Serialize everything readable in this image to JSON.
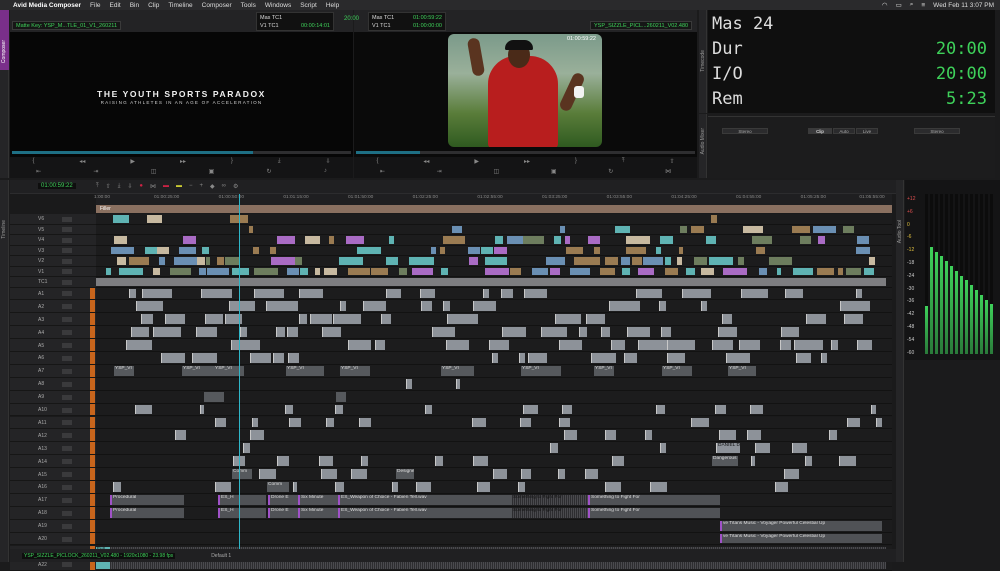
{
  "menubar": {
    "app": "Avid Media Composer",
    "items": [
      "File",
      "Edit",
      "Bin",
      "Clip",
      "Timeline",
      "Composer",
      "Tools",
      "Windows",
      "Script",
      "Help"
    ],
    "clock": "Wed Feb 11  3:07 PM"
  },
  "side_tabs": {
    "composer": "Composer",
    "timeline": "Timeline",
    "audio_tool": "Audio Tool",
    "timecode": "Timecode",
    "audio_mixer": "Audio Mixer"
  },
  "source_monitor": {
    "clip_name": "Matte Key: YSP_M...TLE_01_V1_260211",
    "tc_box": {
      "row1_label": "Mas TC1",
      "row2_label": "V1  TC1",
      "row2_value": "00:00:14:01"
    },
    "title_text": "THE YOUTH SPORTS PARADOX",
    "subtitle_text": "RAISING ATHLETES IN AN AGE OF ACCELERATION"
  },
  "center_tc": "20:00",
  "record_monitor": {
    "clip_name": "YSP_SIZZLE_PICL...260211_V02.480",
    "tc_box": {
      "row1_label": "Mas TC1",
      "row1_value": "01:00:59:22",
      "row2_label": "V1  TC1",
      "row2_value": "01:00:00:00"
    },
    "frame_tc": "01:00:59:22"
  },
  "timecode_window": {
    "rows": [
      {
        "label": "Mas 24",
        "value": ""
      },
      {
        "label": "Dur",
        "value": "20:00"
      },
      {
        "label": "I/O",
        "value": "20:00"
      },
      {
        "label": "Rem",
        "value": "5:23"
      }
    ]
  },
  "audio_mixer": {
    "buttons": [
      "Stereo",
      "Clip",
      "Auto",
      "Live",
      "Stereo"
    ]
  },
  "timeline": {
    "position_tc": "01:00:59:22",
    "filler_label": "Filler",
    "ruler": [
      "1:00:00",
      "01:00:25:00",
      "01:00:50:00",
      "01:01:15:00",
      "01:01:50:00",
      "01:02:25:00",
      "01:02:55:00",
      "01:03:25:00",
      "01:03:55:00",
      "01:04:25:00",
      "01:04:55:00",
      "01:05:25:00",
      "01:05:55:00"
    ],
    "tracks": [
      "V6",
      "V5",
      "V4",
      "V3",
      "V2",
      "V1",
      "TC1",
      "A1",
      "A2",
      "A3",
      "A4",
      "A5",
      "A6",
      "A7",
      "A8",
      "A9",
      "A10",
      "A11",
      "A12",
      "A13",
      "A14",
      "A15",
      "A16",
      "A17",
      "A18",
      "A19",
      "A20",
      "A21",
      "A22"
    ],
    "clips": {
      "procedural": "Procedural",
      "es_h": "ES_H",
      "drone": "Drone E",
      "six_minute": "Six Minute",
      "weapon": "ES_Weapon of Choice - Fabien Tell.wav",
      "something": "Something to Fight For",
      "titans": "ve Titans Music - Voyager   Powerful Celestial Up",
      "dangerous": "Dangerous",
      "comm": "Comm",
      "designed": "Designed",
      "drone_s": "Drone",
      "full": "Full",
      "ysp_vi": "YSP_VI",
      "daniel": "DANIEL D"
    },
    "status": {
      "sequence": "YSP_SIZZLE_PICLOCK_260211_V02.480 - 1920x1080 - 23.98 fps",
      "setting": "Default 1"
    }
  },
  "meters": {
    "scale": [
      "+12",
      "+6",
      "0",
      "-6",
      "-12",
      "-18",
      "-24",
      "-30",
      "-36",
      "-42",
      "-48",
      "-54",
      "-60"
    ]
  },
  "colors": {
    "accent_green": "#3ed15a",
    "playhead": "#2fb6c8",
    "track_orange": "#c8651c"
  }
}
